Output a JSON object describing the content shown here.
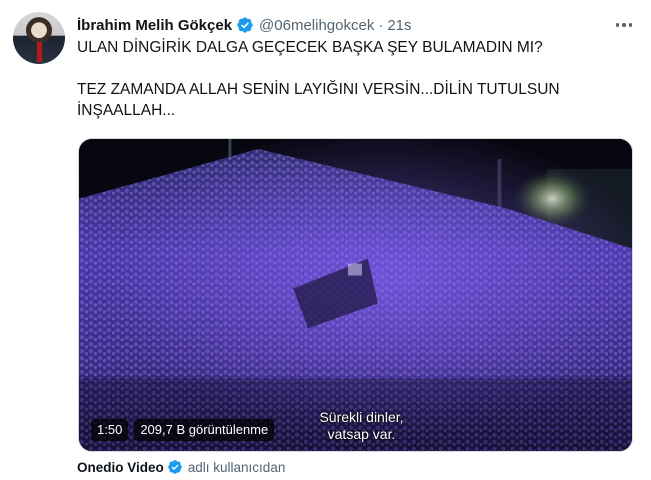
{
  "tweet": {
    "author": {
      "display_name": "İbrahim Melih Gökçek",
      "handle": "@06melihgokcek",
      "verified_icon": "verified-badge-icon",
      "avatar": "avatar"
    },
    "separator": "·",
    "timestamp": "21s",
    "more_icon": "more-options-icon",
    "text_lines": [
      "ULAN DİNGİRİK DALGA GEÇECEK BAŞKA ŞEY BULAMADIN MI?",
      "TEZ ZAMANDA ALLAH SENİN LAYIĞINI VERSİN...DİLİN TUTULSUN",
      "İNŞAALLAH..."
    ],
    "media": {
      "duration": "1:50",
      "view_count": "209,7 B görüntülenme",
      "subtitle_line_1": "Sürekli dinler,",
      "subtitle_line_2": "vatsap var."
    },
    "attribution": {
      "source_name": "Onedio Video",
      "suffix": "adlı kullanıcıdan"
    },
    "colors": {
      "primary_text": "#0f1419",
      "secondary_text": "#536471",
      "verified_blue": "#1d9bf0",
      "border": "#cfd9de"
    }
  }
}
